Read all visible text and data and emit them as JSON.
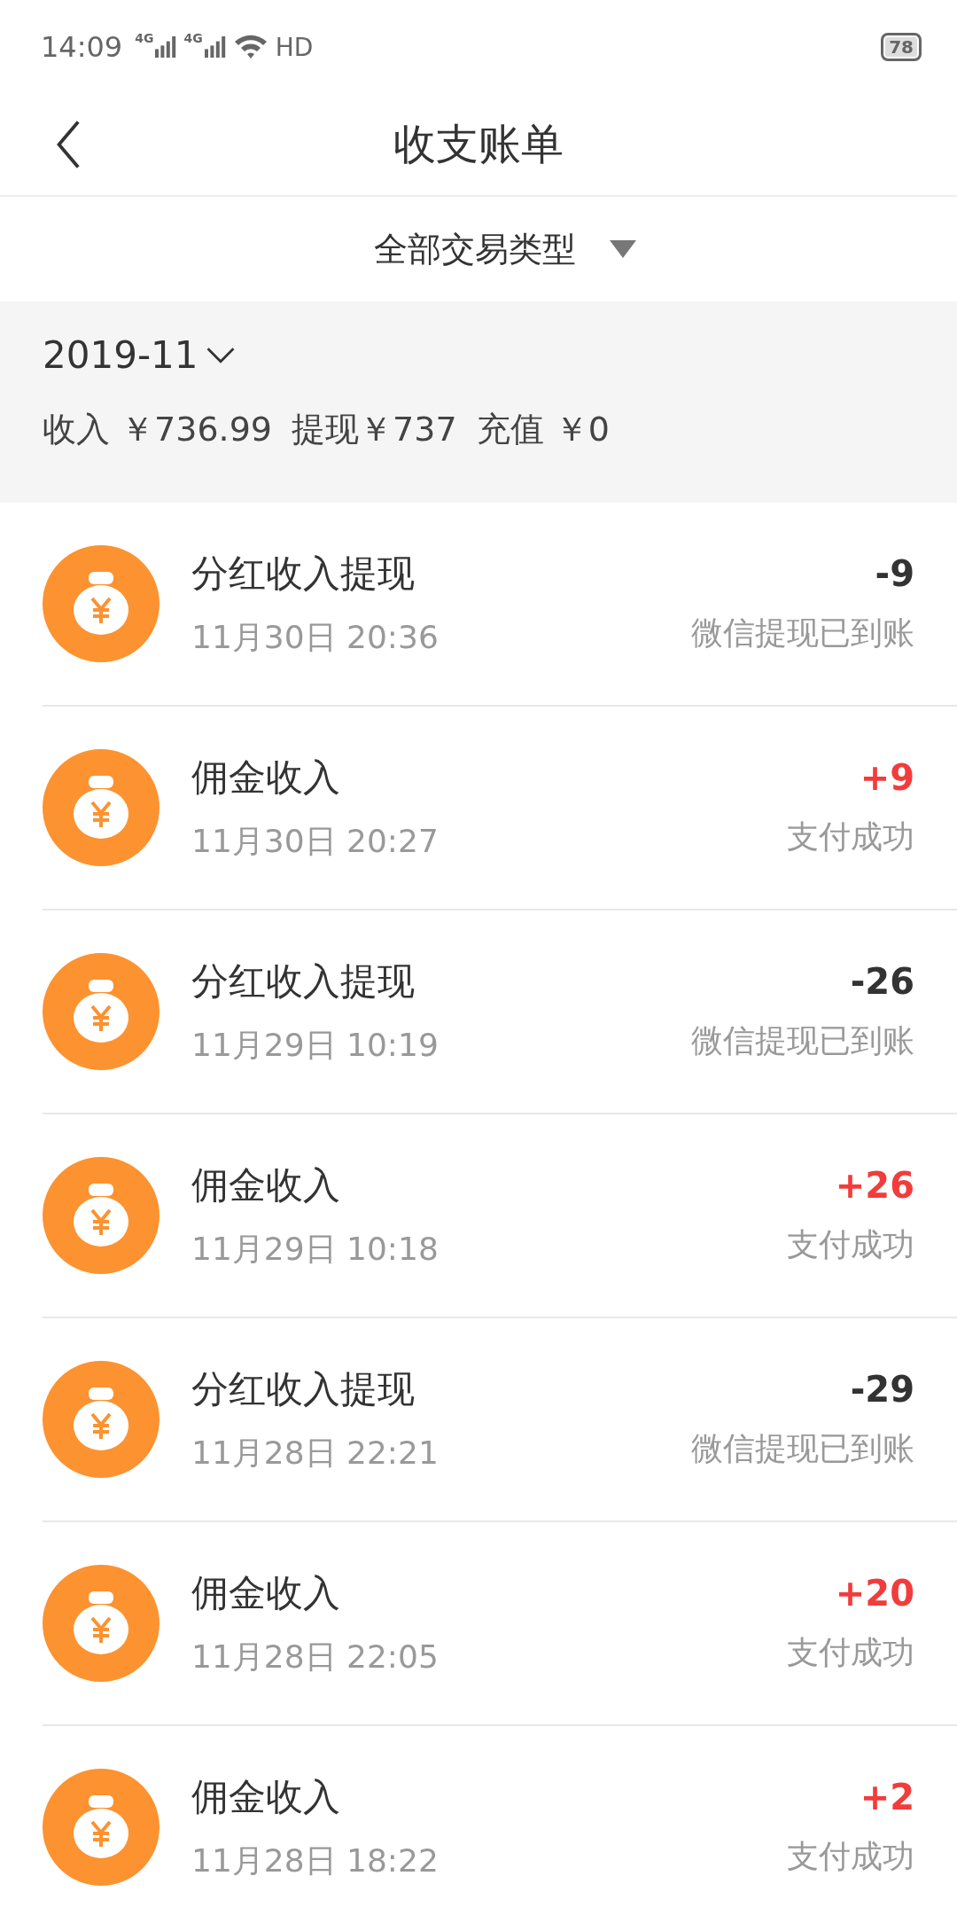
{
  "status_bar": {
    "time": "14:09",
    "network_1": "4G",
    "network_2": "4G",
    "hd": "HD",
    "battery": "78"
  },
  "nav": {
    "title": "收支账单"
  },
  "filter": {
    "label": "全部交易类型"
  },
  "summary": {
    "month": "2019-11",
    "income": "收入 ￥736.99",
    "withdraw": "提现￥737",
    "recharge": "充值 ￥0"
  },
  "transactions": [
    {
      "title": "分红收入提现",
      "time": "11月30日 20:36",
      "amount": "-9",
      "status": "微信提现已到账",
      "kind": "withdrawal"
    },
    {
      "title": "佣金收入",
      "time": "11月30日 20:27",
      "amount": "+9",
      "status": "支付成功",
      "kind": "income"
    },
    {
      "title": "分红收入提现",
      "time": "11月29日 10:19",
      "amount": "-26",
      "status": "微信提现已到账",
      "kind": "withdrawal"
    },
    {
      "title": "佣金收入",
      "time": "11月29日 10:18",
      "amount": "+26",
      "status": "支付成功",
      "kind": "income"
    },
    {
      "title": "分红收入提现",
      "time": "11月28日 22:21",
      "amount": "-29",
      "status": "微信提现已到账",
      "kind": "withdrawal"
    },
    {
      "title": "佣金收入",
      "time": "11月28日 22:05",
      "amount": "+20",
      "status": "支付成功",
      "kind": "income"
    },
    {
      "title": "佣金收入",
      "time": "11月28日 18:22",
      "amount": "+2",
      "status": "支付成功",
      "kind": "income"
    }
  ]
}
